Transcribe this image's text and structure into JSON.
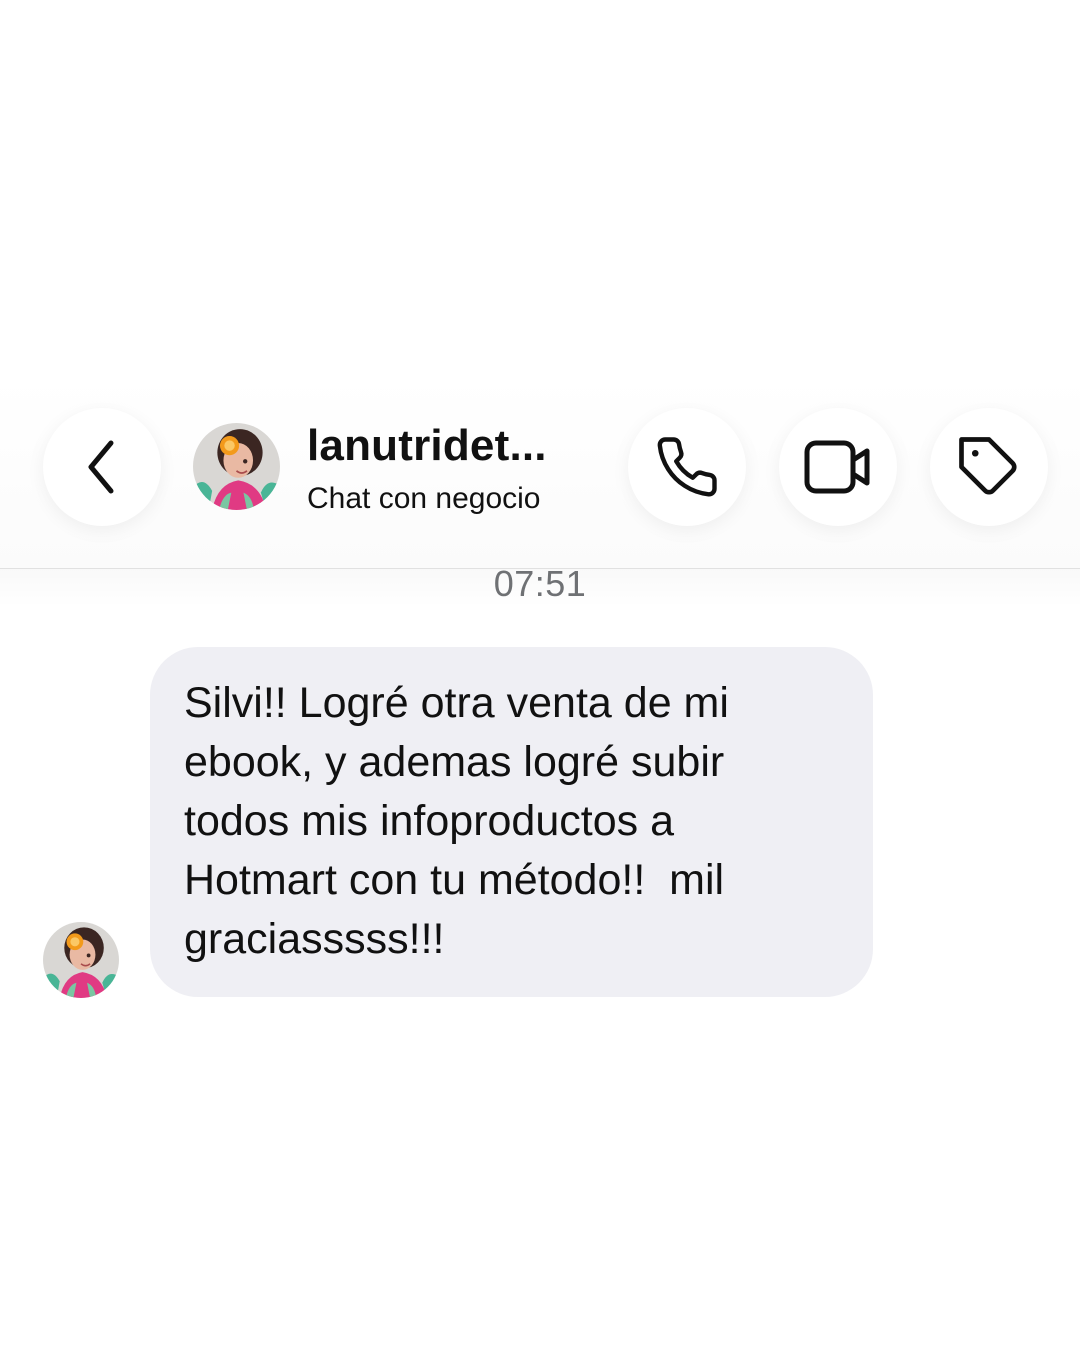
{
  "header": {
    "contact_name": "lanutridet...",
    "subtitle": "Chat con negocio",
    "buttons": {
      "back": "chevron-left-icon",
      "call": "phone-icon",
      "video": "video-camera-icon",
      "tag": "tag-icon"
    }
  },
  "conversation": {
    "timestamp": "07:51",
    "messages": [
      {
        "sender": "lanutridet...",
        "text": "Silvi!! Logré otra venta de mi\nebook, y ademas logré subir\ntodos mis infoproductos a\nHotmart con tu método!!  mil\ngraciasssss!!!"
      }
    ]
  },
  "colors": {
    "background": "#ffffff",
    "bubble": "#efeff4",
    "text": "#111111",
    "timestamp": "#6f7174"
  }
}
